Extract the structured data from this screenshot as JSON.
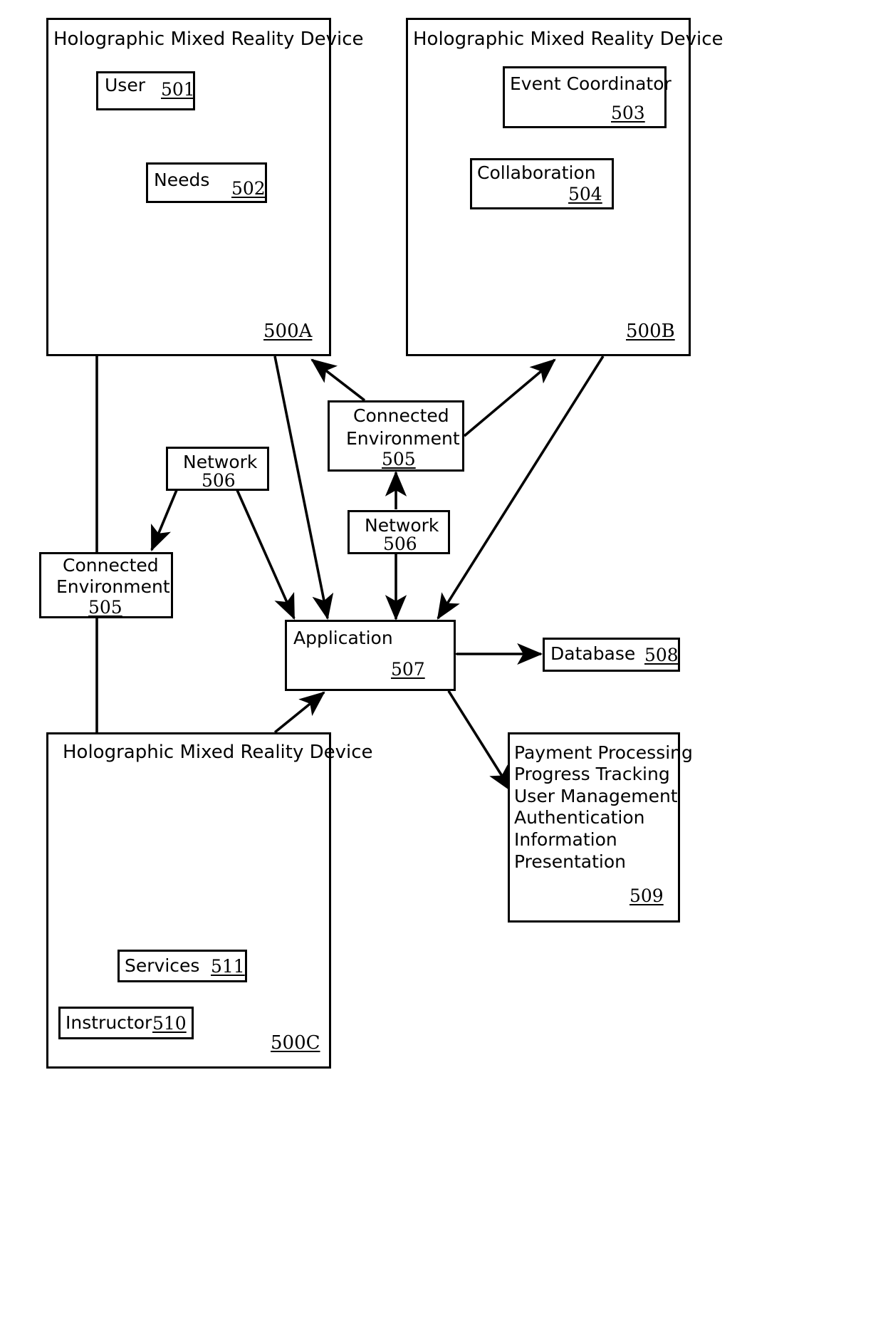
{
  "figure": {
    "kind": "patent-block-diagram",
    "background": "#ffffff",
    "stroke": "#000000"
  },
  "devices": {
    "a": {
      "title": "Holographic Mixed Reality Device",
      "ref": "500A",
      "blocks": [
        {
          "label": "User",
          "ref": "501"
        },
        {
          "label": "Needs",
          "ref": "502"
        }
      ]
    },
    "b": {
      "title": "Holographic Mixed Reality Device",
      "ref": "500B",
      "blocks": [
        {
          "label": "Event Coordinator",
          "ref": "503"
        },
        {
          "label": "Collaboration",
          "ref": "504"
        }
      ]
    },
    "c": {
      "title": "Holographic Mixed Reality Device",
      "ref": "500C",
      "blocks": [
        {
          "label": "Services",
          "ref": "511"
        },
        {
          "label": "Instructor",
          "ref": "510"
        }
      ]
    }
  },
  "nodes": {
    "connected_environment_center": {
      "line1": "Connected",
      "line2": "Environment",
      "ref": "505"
    },
    "connected_environment_left": {
      "line1": "Connected",
      "line2": "Environment",
      "ref": "505"
    },
    "network_left": {
      "label": "Network",
      "ref": "506"
    },
    "network_center": {
      "label": "Network",
      "ref": "506"
    },
    "application": {
      "label": "Application",
      "ref": "507"
    },
    "database": {
      "label": "Database",
      "ref": "508"
    },
    "services_list": {
      "ref": "509",
      "items": [
        "Payment Processing",
        "Progress Tracking",
        "User Management",
        "Authentication",
        "Information",
        "Presentation"
      ]
    }
  }
}
